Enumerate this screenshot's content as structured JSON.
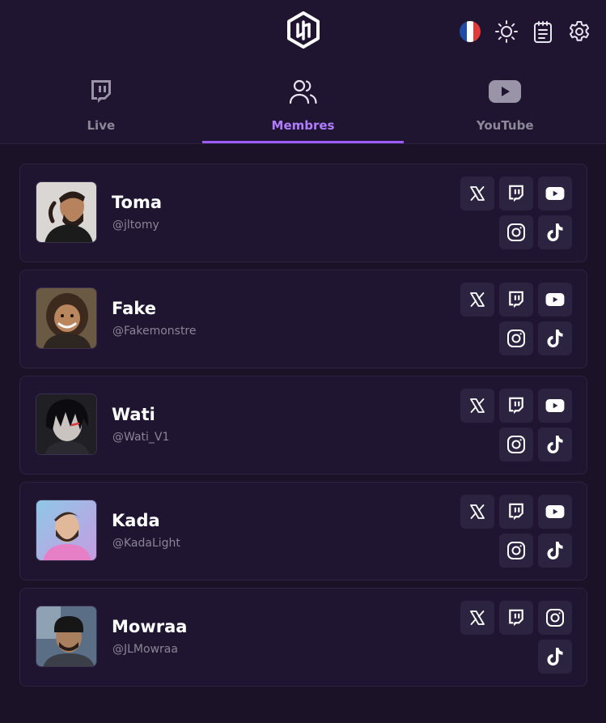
{
  "colors": {
    "background": "#1b1227",
    "card": "#1f1530",
    "button": "#2c2340",
    "accent": "#9b5cf6"
  },
  "header": {
    "logo_icon": "hexagon-logo-icon",
    "actions": [
      {
        "name": "language-flag-fr",
        "icon": "flag-fr-icon"
      },
      {
        "name": "theme-toggle",
        "icon": "sun-icon"
      },
      {
        "name": "notes",
        "icon": "clipboard-icon"
      },
      {
        "name": "settings",
        "icon": "gear-icon"
      }
    ]
  },
  "tabs": [
    {
      "label": "Live",
      "icon": "twitch-icon",
      "active": false
    },
    {
      "label": "Membres",
      "icon": "users-icon",
      "active": true
    },
    {
      "label": "YouTube",
      "icon": "youtube-icon",
      "active": false
    }
  ],
  "members": [
    {
      "name": "Toma",
      "handle": "@jltomy",
      "socials": [
        "x",
        "twitch",
        "youtube",
        "instagram",
        "tiktok"
      ]
    },
    {
      "name": "Fake",
      "handle": "@Fakemonstre",
      "socials": [
        "x",
        "twitch",
        "youtube",
        "instagram",
        "tiktok"
      ]
    },
    {
      "name": "Wati",
      "handle": "@Wati_V1",
      "socials": [
        "x",
        "twitch",
        "youtube",
        "instagram",
        "tiktok"
      ]
    },
    {
      "name": "Kada",
      "handle": "@KadaLight",
      "socials": [
        "x",
        "twitch",
        "youtube",
        "instagram",
        "tiktok"
      ]
    },
    {
      "name": "Mowraa",
      "handle": "@JLMowraa",
      "socials": [
        "x",
        "twitch",
        "instagram",
        "tiktok"
      ]
    }
  ]
}
